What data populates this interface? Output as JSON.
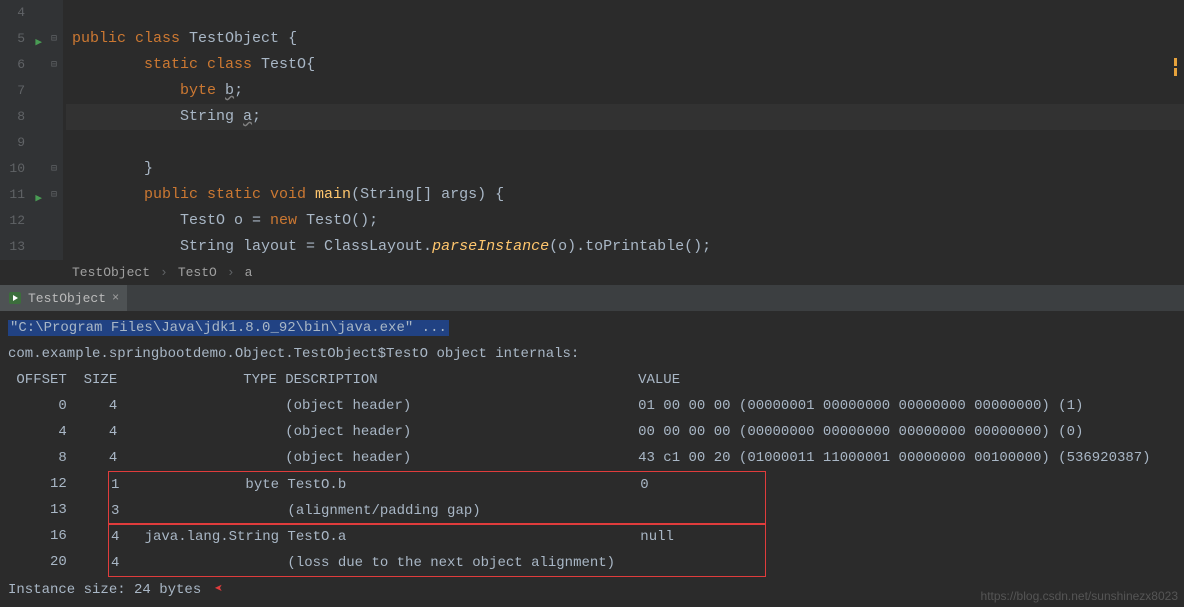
{
  "editor": {
    "lines": [
      {
        "num": "4",
        "html": "",
        "run": false,
        "fold": ""
      },
      {
        "num": "5",
        "html": "<span class='kw'>public class </span><span class='cls'>TestObject </span>{",
        "run": true,
        "fold": "⊟"
      },
      {
        "num": "6",
        "html": "        <span class='kw'>static class </span><span class='cls'>TestO</span>{",
        "run": false,
        "fold": "⊟"
      },
      {
        "num": "7",
        "html": "            <span class='kw'>byte </span><span class='underline'>b</span>;",
        "run": false,
        "fold": ""
      },
      {
        "num": "8",
        "html": "            String <span class='underline'>a</span>;",
        "run": false,
        "fold": "",
        "hl": true
      },
      {
        "num": "9",
        "html": "",
        "run": false,
        "fold": ""
      },
      {
        "num": "10",
        "html": "        }",
        "run": false,
        "fold": "⊟"
      },
      {
        "num": "11",
        "html": "        <span class='kw'>public static void </span><span class='method' style='font-style:normal;color:#ffc66d'>main</span>(String[] args) {",
        "run": true,
        "fold": "⊟"
      },
      {
        "num": "12",
        "html": "            TestO o = <span class='kw'>new </span>TestO();",
        "run": false,
        "fold": ""
      },
      {
        "num": "13",
        "html": "            String layout = ClassLayout.<span class='method'>parseInstance</span>(o).toPrintable();",
        "run": false,
        "fold": ""
      }
    ]
  },
  "breadcrumb": {
    "items": [
      "TestObject",
      "TestO",
      "a"
    ]
  },
  "tab": {
    "label": "TestObject"
  },
  "console": {
    "cmd": "\"C:\\Program Files\\Java\\jdk1.8.0_92\\bin\\java.exe\" ...",
    "header": "com.example.springbootdemo.Object.TestObject$TestO object internals:",
    "cols": " OFFSET  SIZE               TYPE DESCRIPTION                               VALUE",
    "rows": [
      "      0     4                    (object header)                           01 00 00 00 (00000001 00000000 00000000 00000000) (1)",
      "      4     4                    (object header)                           00 00 00 00 (00000000 00000000 00000000 00000000) (0)",
      "      8     4                    (object header)                           43 c1 00 20 (01000011 11000001 00000000 00100000) (536920387)"
    ],
    "boxed1": [
      "     12     1               byte TestO.b                                   0",
      "     13     3                    (alignment/padding gap)                  "
    ],
    "boxed2": [
      "     16     4   java.lang.String TestO.a                                   null",
      "     20     4                    (loss due to the next object alignment)"
    ],
    "footer": "Instance size: 24 bytes"
  },
  "watermark": "https://blog.csdn.net/sunshinezx8023",
  "chart_data": {
    "type": "table",
    "title": "TestObject$TestO object internals",
    "columns": [
      "OFFSET",
      "SIZE",
      "TYPE",
      "DESCRIPTION",
      "VALUE"
    ],
    "rows": [
      {
        "OFFSET": 0,
        "SIZE": 4,
        "TYPE": "",
        "DESCRIPTION": "(object header)",
        "VALUE": "01 00 00 00 (00000001 00000000 00000000 00000000) (1)"
      },
      {
        "OFFSET": 4,
        "SIZE": 4,
        "TYPE": "",
        "DESCRIPTION": "(object header)",
        "VALUE": "00 00 00 00 (00000000 00000000 00000000 00000000) (0)"
      },
      {
        "OFFSET": 8,
        "SIZE": 4,
        "TYPE": "",
        "DESCRIPTION": "(object header)",
        "VALUE": "43 c1 00 20 (01000011 11000001 00000000 00100000) (536920387)"
      },
      {
        "OFFSET": 12,
        "SIZE": 1,
        "TYPE": "byte",
        "DESCRIPTION": "TestO.b",
        "VALUE": "0"
      },
      {
        "OFFSET": 13,
        "SIZE": 3,
        "TYPE": "",
        "DESCRIPTION": "(alignment/padding gap)",
        "VALUE": ""
      },
      {
        "OFFSET": 16,
        "SIZE": 4,
        "TYPE": "java.lang.String",
        "DESCRIPTION": "TestO.a",
        "VALUE": "null"
      },
      {
        "OFFSET": 20,
        "SIZE": 4,
        "TYPE": "",
        "DESCRIPTION": "(loss due to the next object alignment)",
        "VALUE": ""
      }
    ],
    "instance_size_bytes": 24
  }
}
